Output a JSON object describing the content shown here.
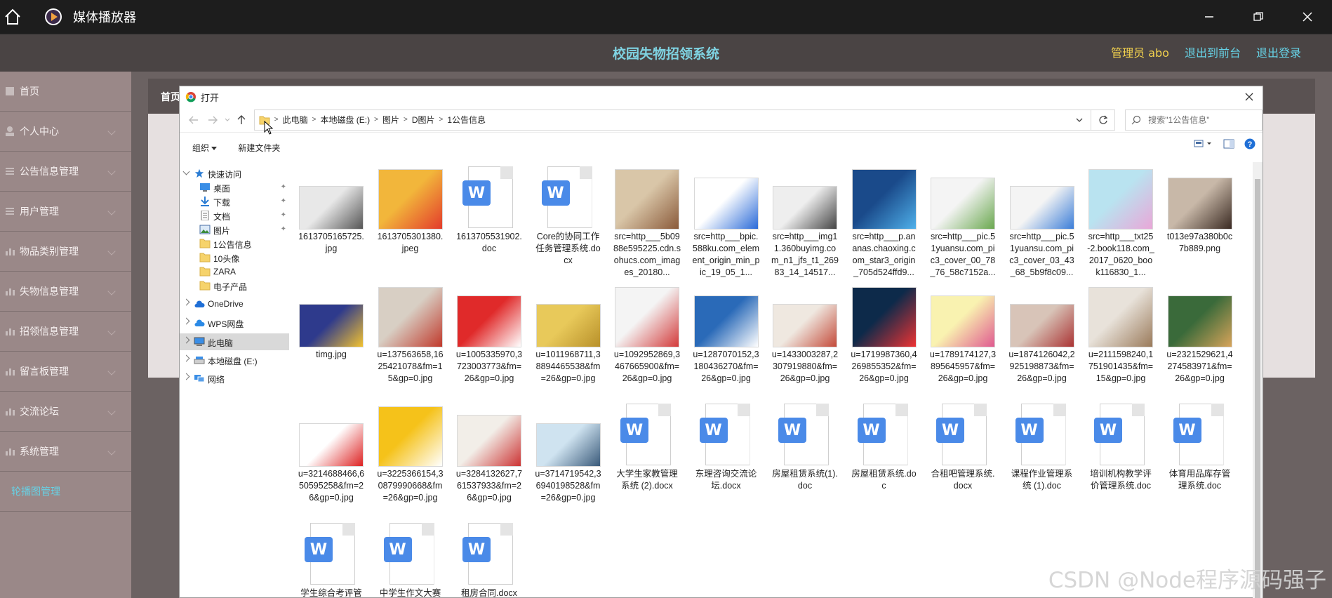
{
  "titlebar": {
    "app_title": "媒体播放器"
  },
  "header": {
    "site_title": "校园失物招领系统",
    "admin_label": "管理员 abo",
    "back_label": "退出到前台",
    "logout_label": "退出登录"
  },
  "sidebar": {
    "items": [
      {
        "label": "首页"
      },
      {
        "label": "个人中心"
      },
      {
        "label": "公告信息管理"
      },
      {
        "label": "用户管理"
      },
      {
        "label": "物品类别管理"
      },
      {
        "label": "失物信息管理"
      },
      {
        "label": "招领信息管理"
      },
      {
        "label": "留言板管理"
      },
      {
        "label": "交流论坛"
      },
      {
        "label": "系统管理"
      },
      {
        "label": "轮播图管理"
      }
    ]
  },
  "content": {
    "breadcrumb": "首页"
  },
  "dialog": {
    "title": "打开",
    "address": [
      "此电脑",
      "本地磁盘 (E:)",
      "图片",
      "D图片",
      "1公告信息"
    ],
    "search_placeholder": "搜索\"1公告信息\"",
    "toolbar": {
      "organize": "组织",
      "new_folder": "新建文件夹"
    },
    "nav": [
      {
        "label": "快速访问",
        "icon": "star-icon"
      },
      {
        "label": "桌面",
        "icon": "desktop-icon"
      },
      {
        "label": "下载",
        "icon": "download-icon"
      },
      {
        "label": "文档",
        "icon": "document-icon"
      },
      {
        "label": "图片",
        "icon": "pictures-icon"
      },
      {
        "label": "1公告信息",
        "icon": "folder-icon"
      },
      {
        "label": "10头像",
        "icon": "folder-icon"
      },
      {
        "label": "ZARA",
        "icon": "folder-icon"
      },
      {
        "label": "电子产品",
        "icon": "folder-icon"
      },
      {
        "label": "OneDrive",
        "icon": "cloud-icon"
      },
      {
        "label": "WPS网盘",
        "icon": "cloud-icon"
      },
      {
        "label": "此电脑",
        "icon": "computer-icon"
      },
      {
        "label": "本地磁盘 (E:)",
        "icon": "drive-icon"
      },
      {
        "label": "网络",
        "icon": "network-icon"
      }
    ],
    "files": [
      {
        "name": "1613705165725.jpg",
        "kind": "img",
        "colors": [
          "#e8e8e8",
          "#555555"
        ]
      },
      {
        "name": "1613705301380.jpeg",
        "kind": "img",
        "colors": [
          "#f2b63b",
          "#e33b2b"
        ]
      },
      {
        "name": "1613705531902.doc",
        "kind": "doc"
      },
      {
        "name": "Core的协同工作任务管理系统.docx",
        "kind": "doc"
      },
      {
        "name": "src=http___5b0988e595225.cdn.sohucs.com_images_20180...",
        "kind": "img",
        "colors": [
          "#d9c6a8",
          "#8a5a3a"
        ]
      },
      {
        "name": "src=http___bpic.588ku.com_element_origin_min_pic_19_05_1...",
        "kind": "img",
        "colors": [
          "#ffffff",
          "#2a6ad8"
        ]
      },
      {
        "name": "src=http___img11.360buyimg.com_n1_jfs_t1_26983_14_14517...",
        "kind": "img",
        "colors": [
          "#eeeeee",
          "#444444"
        ]
      },
      {
        "name": "src=http___p.ananas.chaoxing.com_star3_origin_705d524ffd9...",
        "kind": "img",
        "colors": [
          "#1a4a8a",
          "#4fb0ea"
        ]
      },
      {
        "name": "src=http___pic.51yuansu.com_pic3_cover_00_78_76_58c7152a...",
        "kind": "img",
        "colors": [
          "#f4f4f4",
          "#6aa84f"
        ]
      },
      {
        "name": "src=http___pic.51yuansu.com_pic3_cover_03_43_68_5b9f8c09...",
        "kind": "img",
        "colors": [
          "#f4f4f4",
          "#3b7dd8"
        ]
      },
      {
        "name": "src=http___txt25-2.book118.com_2017_0620_book116830_1...",
        "kind": "img",
        "colors": [
          "#b9e3f0",
          "#e9a7d8"
        ]
      },
      {
        "name": "t013e97a380b0c7b889.png",
        "kind": "img",
        "colors": [
          "#c8b8a8",
          "#3a2a22"
        ]
      },
      {
        "name": "timg.jpg",
        "kind": "img",
        "colors": [
          "#2e3a8c",
          "#f2c230"
        ]
      },
      {
        "name": "u=137563658,1625421078&fm=15&gp=0.jpg",
        "kind": "img",
        "colors": [
          "#d8cfc4",
          "#c0392b"
        ]
      },
      {
        "name": "u=1005335970,3723003773&fm=26&gp=0.jpg",
        "kind": "img",
        "colors": [
          "#e02a2a",
          "#ffffff"
        ]
      },
      {
        "name": "u=1011968711,38894465538&fm=26&gp=0.jpg",
        "kind": "img",
        "colors": [
          "#e8c95a",
          "#b8902a"
        ]
      },
      {
        "name": "u=1092952869,3467665900&fm=26&gp=0.jpg",
        "kind": "img",
        "colors": [
          "#f4f4f4",
          "#d33a3a"
        ]
      },
      {
        "name": "u=1287070152,3180436270&fm=26&gp=0.jpg",
        "kind": "img",
        "colors": [
          "#2a6ab8",
          "#ffffff"
        ]
      },
      {
        "name": "u=1433003287,2307919880&fm=26&gp=0.jpg",
        "kind": "img",
        "colors": [
          "#efe8e0",
          "#c44a3a"
        ]
      },
      {
        "name": "u=1719987360,4269855352&fm=26&gp=0.jpg",
        "kind": "img",
        "colors": [
          "#0d2a4a",
          "#e33"
        ]
      },
      {
        "name": "u=1789174127,3895645957&fm=26&gp=0.jpg",
        "kind": "img",
        "colors": [
          "#f9f2b0",
          "#e05a90"
        ]
      },
      {
        "name": "u=1874126042,2925198873&fm=26&gp=0.jpg",
        "kind": "img",
        "colors": [
          "#d8c4b8",
          "#a33"
        ]
      },
      {
        "name": "u=2111598240,1751901435&fm=15&gp=0.jpg",
        "kind": "img",
        "colors": [
          "#e8e2da",
          "#9a7a5a"
        ]
      },
      {
        "name": "u=2321529621,4274583971&fm=26&gp=0.jpg",
        "kind": "img",
        "colors": [
          "#3a6a3a",
          "#d8a45a"
        ]
      },
      {
        "name": "u=3214688466,650595258&fm=26&gp=0.jpg",
        "kind": "img",
        "colors": [
          "#ffffff",
          "#d22"
        ]
      },
      {
        "name": "u=3225366154,30879990668&fm=26&gp=0.jpg",
        "kind": "img",
        "colors": [
          "#f5c21a",
          "#ffffff"
        ]
      },
      {
        "name": "u=3284132627,761537933&fm=26&gp=0.jpg",
        "kind": "img",
        "colors": [
          "#f2eee8",
          "#c33"
        ]
      },
      {
        "name": "u=3714719542,36940198528&fm=26&gp=0.jpg",
        "kind": "img",
        "colors": [
          "#cfe3f0",
          "#3a5a7a"
        ]
      },
      {
        "name": "大学生家教管理系统 (2).docx",
        "kind": "doc"
      },
      {
        "name": "东理咨询交流论坛.docx",
        "kind": "doc"
      },
      {
        "name": "房屋租赁系统(1).doc",
        "kind": "doc"
      },
      {
        "name": "房屋租赁系统.doc",
        "kind": "doc"
      },
      {
        "name": "合租吧管理系统.docx",
        "kind": "doc"
      },
      {
        "name": "课程作业管理系统 (1).doc",
        "kind": "doc"
      },
      {
        "name": "培训机构教学评价管理系统.doc",
        "kind": "doc"
      },
      {
        "name": "体育用品库存管理系统.doc",
        "kind": "doc"
      },
      {
        "name": "学生综合考评管",
        "kind": "doc"
      },
      {
        "name": "中学生作文大赛",
        "kind": "doc"
      },
      {
        "name": "租房合同.docx",
        "kind": "doc"
      }
    ]
  },
  "watermark": "CSDN @Node程序源码强子",
  "colors": {
    "accent": "#66d2e6",
    "admin": "#f3d24e",
    "sidebar": "#9a8888",
    "titlebar": "#1d1d1d"
  }
}
